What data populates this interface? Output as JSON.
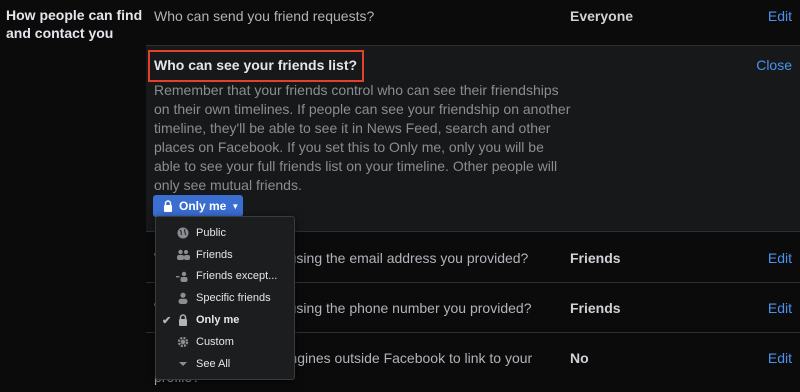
{
  "section": {
    "label": "How people can find and contact you"
  },
  "rows": [
    {
      "question": "Who can send you friend requests?",
      "value": "Everyone",
      "edit": "Edit"
    },
    {
      "question": "Who can look you up using the email address you provided?",
      "value": "Friends",
      "edit": "Edit"
    },
    {
      "question": "Who can look you up using the phone number you provided?",
      "value": "Friends",
      "edit": "Edit"
    },
    {
      "question": "Do you want search engines outside Facebook to link to your",
      "question_cont": "profile?",
      "value": "No",
      "edit": "Edit"
    }
  ],
  "expanded": {
    "title": "Who can see your friends list?",
    "close": "Close",
    "description": "Remember that your friends control who can see their friendships on their own timelines. If people can see your friendship on another timeline, they'll be able to see it in News Feed, search and other places on Facebook. If you set this to Only me, only you will be able to see your full friends list on your timeline. Other people will only see mutual friends.",
    "button": "Only me"
  },
  "menu": {
    "items": [
      {
        "label": "Public",
        "icon": "globe-icon",
        "selected": false
      },
      {
        "label": "Friends",
        "icon": "friends-icon",
        "selected": false
      },
      {
        "label": "Friends except...",
        "icon": "friends-except-icon",
        "selected": false
      },
      {
        "label": "Specific friends",
        "icon": "person-icon",
        "selected": false
      },
      {
        "label": "Only me",
        "icon": "lock-icon",
        "selected": true
      },
      {
        "label": "Custom",
        "icon": "gear-icon",
        "selected": false
      },
      {
        "label": "See All",
        "icon": "chevron-down-icon",
        "selected": false
      }
    ]
  },
  "colors": {
    "accent": "#4b93f0",
    "button": "#3a6ed1",
    "highlight": "#e2412b"
  }
}
